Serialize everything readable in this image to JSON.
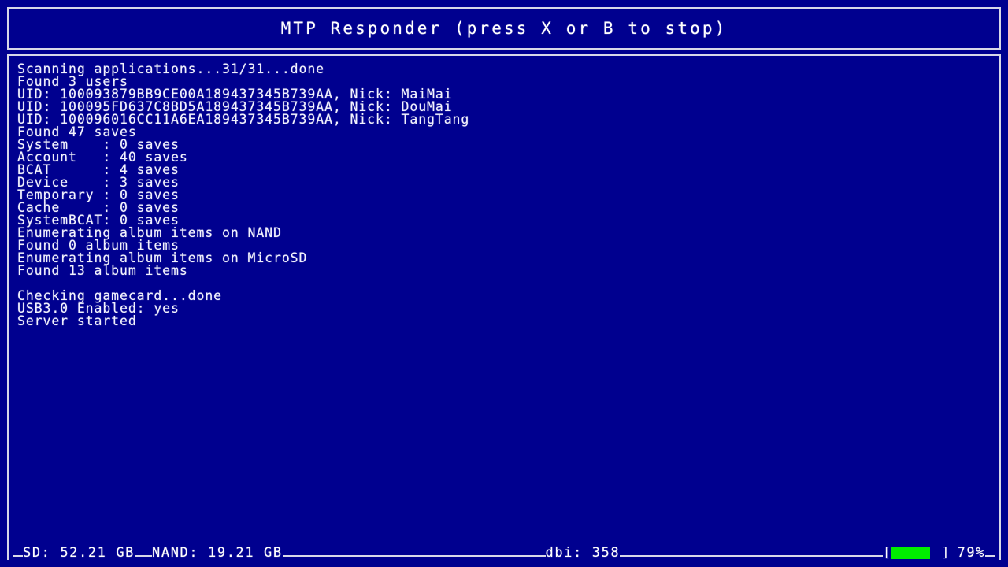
{
  "header": {
    "title": "MTP Responder (press X or B to stop)"
  },
  "colors": {
    "background": "#00008f",
    "border": "#d8d8e8",
    "text": "#ffffff",
    "battery_fill": "#00ee00"
  },
  "console": {
    "lines": [
      "Scanning applications...31/31...done",
      "Found 3 users",
      "UID: 100093879BB9CE00A189437345B739AA, Nick: MaiMai",
      "UID: 100095FD637C8BD5A189437345B739AA, Nick: DouMai",
      "UID: 100096016CC11A6EA189437345B739AA, Nick: TangTang",
      "Found 47 saves",
      "System    : 0 saves",
      "Account   : 40 saves",
      "BCAT      : 4 saves",
      "Device    : 3 saves",
      "Temporary : 0 saves",
      "Cache     : 0 saves",
      "SystemBCAT: 0 saves",
      "Enumerating album items on NAND",
      "Found 0 album items",
      "Enumerating album items on MicroSD",
      "Found 13 album items",
      "",
      "Checking gamecard...done",
      "USB3.0 Enabled: yes",
      "Server started"
    ]
  },
  "status": {
    "sd_label": "SD: 52.21 GB",
    "nand_label": "NAND: 19.21 GB",
    "dbi_label": "dbi: 358",
    "battery_bracket_open": "[",
    "battery_bracket_close": "]",
    "battery_percent_label": "79%",
    "battery_percent_value": 79
  }
}
